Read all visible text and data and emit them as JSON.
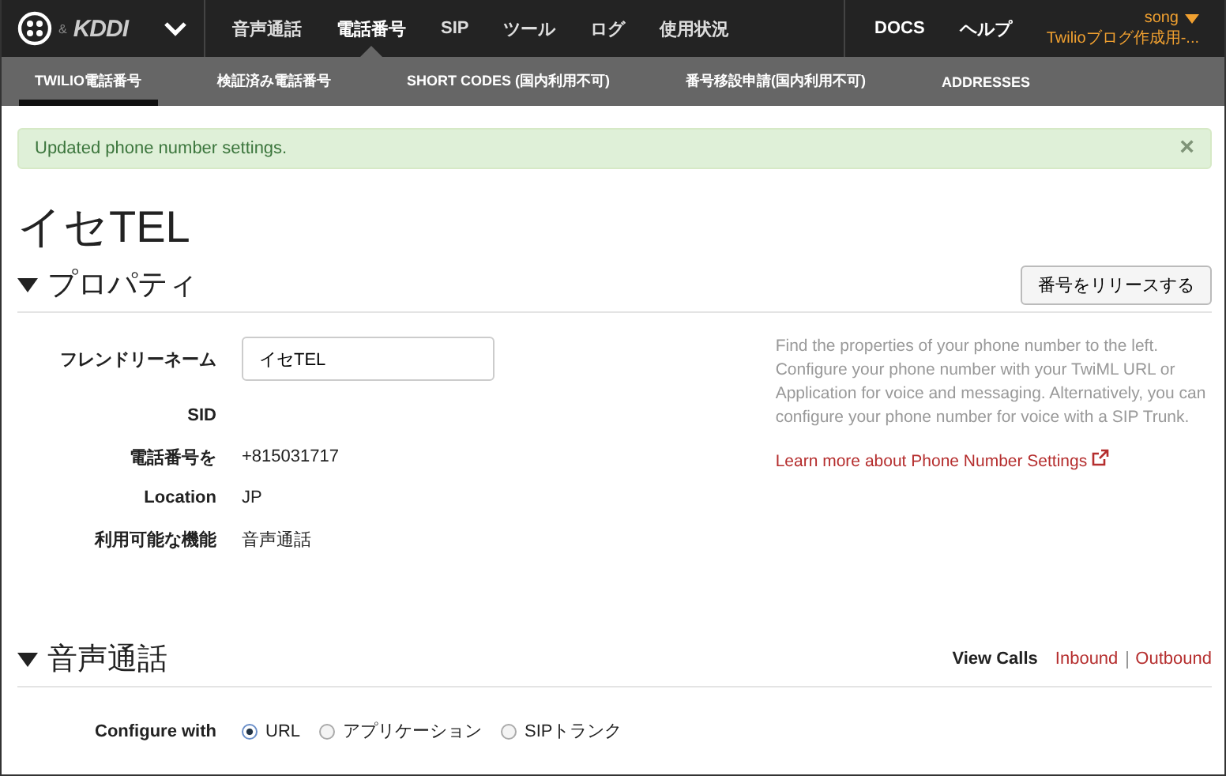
{
  "topnav": {
    "brand": "KDDI",
    "amp": "&",
    "items": [
      {
        "label": "音声通話",
        "selected": false
      },
      {
        "label": "電話番号",
        "selected": true
      },
      {
        "label": "SIP",
        "selected": false
      },
      {
        "label": "ツール",
        "selected": false
      },
      {
        "label": "ログ",
        "selected": false
      },
      {
        "label": "使用状況",
        "selected": false
      }
    ],
    "right_items": [
      "DOCS",
      "ヘルプ"
    ],
    "user": "song",
    "account": "Twilioブログ作成用-..."
  },
  "subnav": [
    {
      "label": "TWILIO電話番号",
      "selected": true
    },
    {
      "label": "検証済み電話番号",
      "selected": false
    },
    {
      "label": "SHORT CODES (国内利用不可)",
      "selected": false
    },
    {
      "label": "番号移設申請(国内利用不可)",
      "selected": false
    },
    {
      "label": "ADDRESSES",
      "selected": false
    }
  ],
  "alert": {
    "message": "Updated phone number settings.",
    "close": "×"
  },
  "title": "イセTEL",
  "properties": {
    "heading": "プロパティ",
    "expanded": true,
    "release_button": "番号をリリースする",
    "fields": [
      {
        "kind": "input",
        "label": "フレンドリーネーム",
        "value": "イセTEL"
      },
      {
        "kind": "text",
        "label": "SID"
      },
      {
        "kind": "text",
        "label": "電話番号を",
        "value": "+815031717"
      },
      {
        "kind": "text",
        "label": "Location",
        "value": "JP"
      },
      {
        "kind": "text",
        "label": "利用可能な機能",
        "value": "音声通話"
      }
    ],
    "help": "Find the properties of your phone number to the left. Configure your phone number with your TwiML URL or Application for voice and messaging. Alternatively, you can configure your phone number for voice with a SIP Trunk.",
    "help_link": "Learn more about Phone Number Settings"
  },
  "voice": {
    "heading": "音声通話",
    "expanded": true,
    "view_calls": "View Calls",
    "links": [
      "Inbound",
      "Outbound"
    ],
    "configure_label": "Configure with",
    "options": [
      {
        "label": "URL",
        "selected": true
      },
      {
        "label": "アプリケーション",
        "selected": false
      },
      {
        "label": "SIPトランク",
        "selected": false
      }
    ]
  }
}
